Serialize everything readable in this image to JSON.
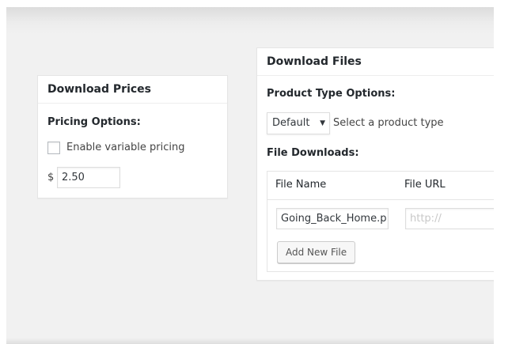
{
  "prices_box": {
    "title": "Download Prices",
    "pricing_options_label": "Pricing Options:",
    "variable_pricing_label": "Enable variable pricing",
    "variable_pricing_checked": false,
    "currency_symbol": "$",
    "price_value": "2.50"
  },
  "files_box": {
    "title": "Download Files",
    "product_type_label": "Product Type Options:",
    "product_type_selected": "Default",
    "product_type_hint": "Select a product type",
    "file_downloads_label": "File Downloads:",
    "table": {
      "columns": [
        "File Name",
        "File URL"
      ],
      "rows": [
        {
          "file_name": "Going_Back_Home.p",
          "file_url_placeholder": "http://"
        }
      ]
    },
    "add_file_button": "Add New File"
  }
}
